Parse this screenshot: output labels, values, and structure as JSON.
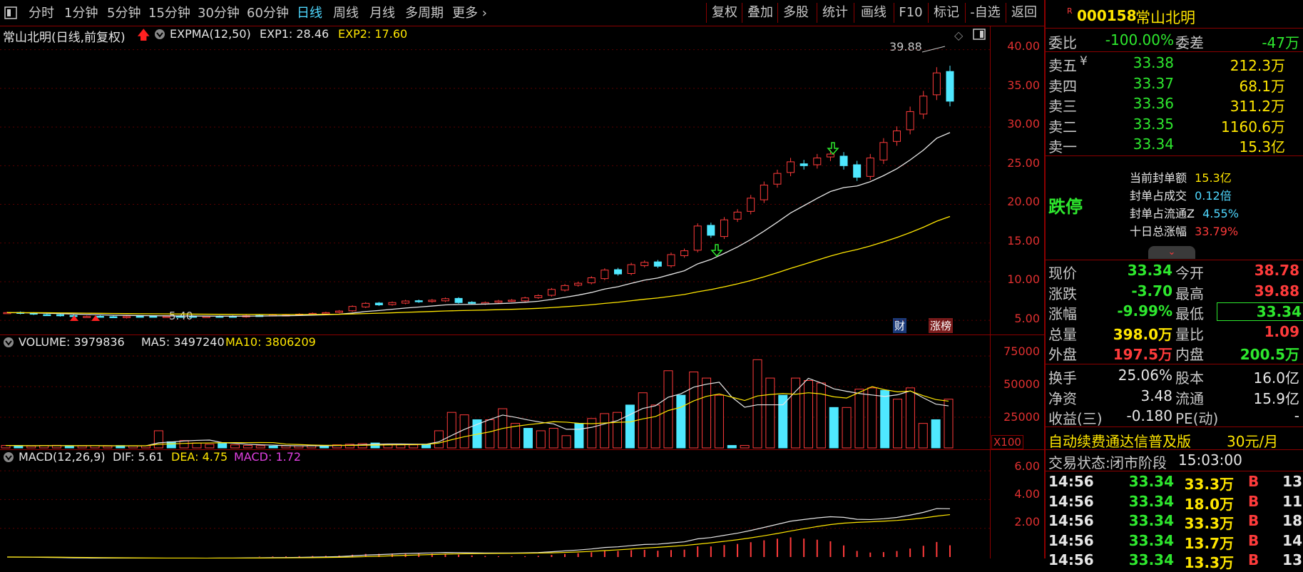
{
  "toolbar": {
    "periods": [
      "分时",
      "1分钟",
      "5分钟",
      "15分钟",
      "30分钟",
      "60分钟",
      "日线",
      "周线",
      "月线",
      "多周期",
      "更多"
    ],
    "active_period": "日线",
    "right_buttons": [
      "复权",
      "叠加",
      "多股",
      "统计",
      "画线",
      "F10",
      "标记",
      "-自选",
      "返回"
    ]
  },
  "main_panel": {
    "title": "常山北明(日线,前复权)",
    "indicator": "EXPMA(12,50)",
    "exp1": "EXP1: 28.46",
    "exp2": "EXP2: 17.60",
    "high_label": "39.88",
    "low_label": "5.40",
    "tag_cai": "财",
    "tag_zhangbang": "涨榜",
    "yticks": [
      "40.00",
      "35.00",
      "30.00",
      "25.00",
      "20.00",
      "15.00",
      "10.00",
      "5.00"
    ]
  },
  "volume_panel": {
    "label": "VOLUME: 3979836",
    "ma5": "MA5: 3497240",
    "ma10": "MA10: 3806209",
    "yticks": [
      "75000",
      "50000",
      "25000"
    ],
    "unit": "X100"
  },
  "macd_panel": {
    "label": "MACD(12,26,9)",
    "dif": "DIF: 5.61",
    "dea": "DEA: 4.75",
    "macd": "MACD: 1.72",
    "yticks": [
      "6.00",
      "4.00",
      "2.00"
    ]
  },
  "chart_data": {
    "type": "candlestick",
    "price_ylim": [
      4,
      42
    ],
    "closes": [
      6.0,
      5.9,
      5.8,
      5.7,
      5.6,
      5.5,
      5.5,
      5.45,
      5.4,
      5.5,
      5.5,
      5.5,
      5.5,
      5.5,
      5.5,
      5.5,
      5.5,
      5.5,
      5.6,
      5.6,
      5.7,
      5.7,
      5.8,
      5.9,
      6.0,
      6.2,
      6.8,
      7.2,
      7.0,
      7.3,
      7.5,
      7.4,
      7.6,
      7.8,
      7.3,
      7.2,
      7.3,
      7.5,
      7.6,
      7.9,
      8.2,
      9.0,
      9.5,
      9.8,
      10.5,
      11.5,
      11.0,
      12.2,
      12.5,
      12.0,
      13.5,
      14.0,
      17.2,
      16.0,
      18.0,
      19.0,
      20.8,
      22.5,
      24.0,
      25.5,
      25.0,
      26.0,
      26.5,
      25.0,
      23.5,
      26.0,
      28.0,
      29.5,
      32.0,
      34.0,
      37.0,
      33.34
    ],
    "volume_x100": [
      2000,
      1800,
      1500,
      1900,
      2100,
      1700,
      1600,
      1800,
      1500,
      1900,
      1600,
      1700,
      14000,
      5000,
      6000,
      4000,
      3000,
      3500,
      2500,
      2000,
      1800,
      1500,
      1700,
      1600,
      2000,
      1900,
      2500,
      3000,
      3500,
      4000,
      3000,
      2500,
      2500,
      3000,
      14000,
      29000,
      27000,
      23000,
      23000,
      32000,
      20000,
      16000,
      14000,
      16000,
      10000,
      20000,
      24000,
      28000,
      29000,
      35000,
      45000,
      35000,
      63000,
      43000,
      62000,
      57000,
      43000,
      2000,
      2000,
      72000,
      57000,
      43000,
      57000,
      55000,
      53000,
      33000,
      33000,
      48000,
      49000,
      47000,
      39800,
      49000,
      20000,
      23000,
      39800
    ],
    "volume_ylim": [
      0,
      85000
    ],
    "macd_ylim": [
      0,
      7
    ]
  },
  "side": {
    "code": "000158",
    "name": "常山北明",
    "r_badge": "R",
    "weibi_label": "委比",
    "weibi_value": "-100.00%",
    "weicha_label": "委差",
    "weicha_value": "-47万",
    "asks": [
      {
        "label": "卖五",
        "price": "33.38",
        "vol": "212.3万"
      },
      {
        "label": "卖四",
        "price": "33.37",
        "vol": "68.1万"
      },
      {
        "label": "卖三",
        "price": "33.36",
        "vol": "311.2万"
      },
      {
        "label": "卖二",
        "price": "33.35",
        "vol": "1160.6万"
      },
      {
        "label": "卖一",
        "price": "33.34",
        "vol": "15.3亿"
      }
    ],
    "yen_mark": "¥",
    "limit_status": "跌停",
    "limit_info": [
      {
        "k": "当前封单额",
        "v": "15.3亿"
      },
      {
        "k": "封单占成交",
        "v": "0.12倍"
      },
      {
        "k": "封单占流通Z",
        "v": "4.55%"
      },
      {
        "k": "十日总涨幅",
        "v": "33.79%"
      }
    ],
    "quote": [
      {
        "l1": "现价",
        "v1": "33.34",
        "l2": "今开",
        "v2": "38.78"
      },
      {
        "l1": "涨跌",
        "v1": "-3.70",
        "l2": "最高",
        "v2": "39.88"
      },
      {
        "l1": "涨幅",
        "v1": "-9.99%",
        "l2": "最低",
        "v2": "33.34"
      },
      {
        "l1": "总量",
        "v1": "398.0万",
        "l2": "量比",
        "v2": "1.09"
      },
      {
        "l1": "外盘",
        "v1": "197.5万",
        "l2": "内盘",
        "v2": "200.5万"
      }
    ],
    "fund": [
      {
        "l1": "换手",
        "v1": "25.06%",
        "l2": "股本",
        "v2": "16.0亿"
      },
      {
        "l1": "净资",
        "v1": "3.48",
        "l2": "流通",
        "v2": "15.9亿"
      },
      {
        "l1": "收益(三)",
        "v1": "-0.180",
        "l2": "PE(动)",
        "v2": "-"
      }
    ],
    "promo": "自动续费通达信普及版",
    "promo_price": "30元/月",
    "trade_status_label": "交易状态:",
    "trade_status_value": "闭市阶段",
    "trade_time": "15:03:00",
    "ticks": [
      {
        "t": "14:56",
        "p": "33.34",
        "v": "33.3万",
        "s": "B",
        "n": "13"
      },
      {
        "t": "14:56",
        "p": "33.34",
        "v": "18.0万",
        "s": "B",
        "n": "11"
      },
      {
        "t": "14:56",
        "p": "33.34",
        "v": "33.3万",
        "s": "B",
        "n": "18"
      },
      {
        "t": "14:56",
        "p": "33.34",
        "v": "13.7万",
        "s": "B",
        "n": "14"
      },
      {
        "t": "14:56",
        "p": "33.34",
        "v": "13.3万",
        "s": "B",
        "n": "13"
      }
    ]
  }
}
